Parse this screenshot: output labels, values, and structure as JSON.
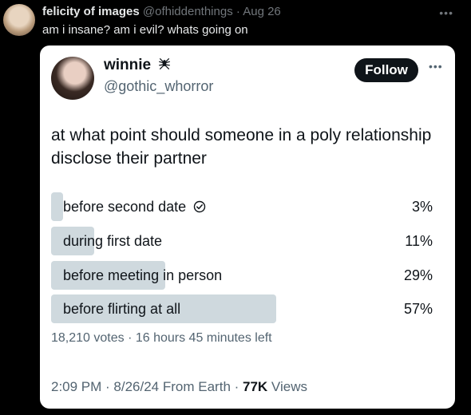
{
  "outer_tweet": {
    "display_name": "felicity of images",
    "handle": "@ofhiddenthings",
    "separator": " · ",
    "date": "Aug 26",
    "text": "am i insane? am i evil? whats going on",
    "more_icon": "more-horizontal-icon"
  },
  "quoted_tweet": {
    "display_name": "winnie",
    "name_emoji_icon": "spider-icon",
    "handle": "@gothic_whorror",
    "follow_label": "Follow",
    "question": "at what point should someone in a poly relationship disclose their partner",
    "poll": {
      "options": [
        {
          "label": "before second date",
          "percent_label": "3%",
          "percent": 3,
          "selected_icon": "check-circle-icon"
        },
        {
          "label": "during first date",
          "percent_label": "11%",
          "percent": 11
        },
        {
          "label": "before meeting in person",
          "percent_label": "29%",
          "percent": 29
        },
        {
          "label": "before flirting at all",
          "percent_label": "57%",
          "percent": 57
        }
      ],
      "votes": "18,210 votes",
      "sep": " · ",
      "time_left": "16 hours 45 minutes left"
    },
    "meta": {
      "time": "2:09 PM",
      "sep1": " · ",
      "date": "8/26/24",
      "source": " From Earth",
      "sep2": " · ",
      "views_count": "77K",
      "views_label": " Views"
    }
  },
  "colors": {
    "page_background": "#000000",
    "poll_bar": "#cfd9de",
    "follow_button": "#0f1419"
  }
}
